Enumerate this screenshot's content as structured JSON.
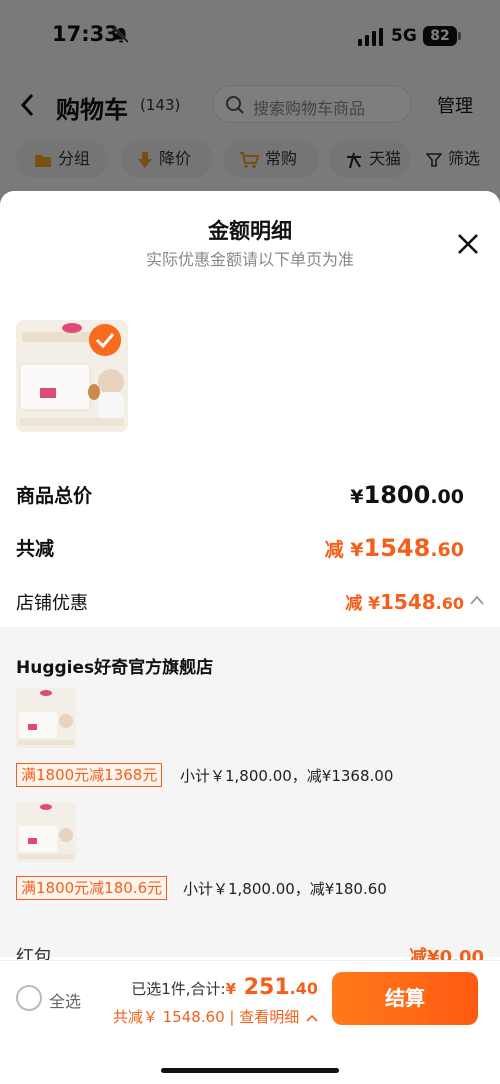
{
  "status_bar": {
    "time": "17:33",
    "network": "5G",
    "battery": "82"
  },
  "nav": {
    "title": "购物车",
    "count": "(143)",
    "search_placeholder": "搜索购物车商品",
    "manage": "管理"
  },
  "filters": [
    "分组",
    "降价",
    "常购",
    "天猫",
    "筛选"
  ],
  "sheet": {
    "title": "金额明细",
    "subtitle": "实际优惠金额请以下单页为准",
    "total_price": {
      "label": "商品总价",
      "symbol": "¥",
      "int": "1800",
      "dec": ".00"
    },
    "total_reduce": {
      "label": "共减",
      "prefix": "减 ",
      "symbol": "¥",
      "int": "1548",
      "dec": ".60"
    },
    "shop_discount": {
      "label": "店铺优惠",
      "prefix": "减 ",
      "symbol": "¥",
      "int": "1548",
      "dec": ".60"
    },
    "shop": {
      "name": "Huggies好奇官方旗舰店",
      "items": [
        {
          "tag": "满1800元减1368元",
          "detail": "小计￥1,800.00，减¥1368.00"
        },
        {
          "tag": "满1800元减180.6元",
          "detail": "小计￥1,800.00，减¥180.60"
        }
      ]
    },
    "partial_row": {
      "label": "红包",
      "value": "减¥0.00"
    }
  },
  "footer": {
    "select_all": "全选",
    "selected_text": "已选1件,合计:",
    "total_symbol": "¥",
    "total_int": " 251",
    "total_dec": ".40",
    "reduce_text": "共减￥ 1548.60 | 查看明细",
    "checkout": "结算"
  },
  "colors": {
    "accent": "#f4601b",
    "overlay": "rgba(0,0,0,0.5)"
  }
}
